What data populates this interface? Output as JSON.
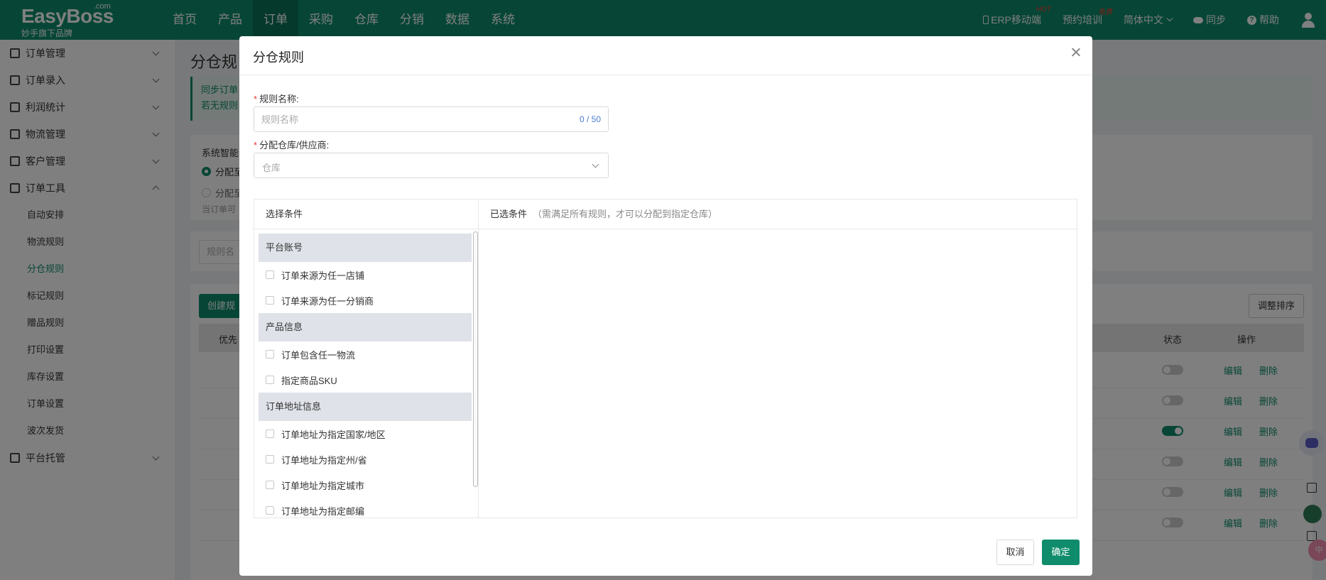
{
  "header": {
    "brand": "EasyBoss",
    "brand_suffix": ".com",
    "slogan": "妙手旗下品牌",
    "nav": [
      "首页",
      "产品",
      "订单",
      "采购",
      "仓库",
      "分销",
      "数据",
      "系统"
    ],
    "active_nav": "订单",
    "erp_mobile": "ERP移动端",
    "erp_badge": "HOT",
    "training": "预约培训",
    "training_badge": "免费",
    "language": "简体中文",
    "sync": "同步",
    "help": "帮助"
  },
  "sidebar": {
    "groups": [
      {
        "label": "订单管理",
        "expanded": false
      },
      {
        "label": "订单录入",
        "expanded": false
      },
      {
        "label": "利润统计",
        "expanded": false
      },
      {
        "label": "物流管理",
        "expanded": false
      },
      {
        "label": "客户管理",
        "expanded": false
      },
      {
        "label": "订单工具",
        "expanded": true
      }
    ],
    "sub_items": [
      "自动安排",
      "物流规则",
      "分仓规则",
      "标记规则",
      "赠品规则",
      "打印设置",
      "库存设置",
      "订单设置",
      "波次发货"
    ],
    "active_sub": "分仓规则",
    "last_group": {
      "label": "平台托管",
      "expanded": false
    }
  },
  "background": {
    "page_title": "分仓规",
    "notice_line1": "同步订单",
    "notice_line2": "若无规则",
    "smart_label": "系统智能",
    "radio1": "分配至",
    "radio2": "分配至",
    "hint": "当订单可",
    "search_placeholder": "规则名",
    "create_button": "创建规",
    "sort_button": "调整排序",
    "col_priority": "优先",
    "col_status": "状态",
    "col_action": "操作",
    "rows": [
      {
        "on": false,
        "edit": "编辑",
        "delete": "删除"
      },
      {
        "on": false,
        "edit": "编辑",
        "delete": "删除"
      },
      {
        "on": true,
        "edit": "编辑",
        "delete": "删除"
      },
      {
        "on": false,
        "edit": "编辑",
        "delete": "删除"
      },
      {
        "on": false,
        "edit": "编辑",
        "delete": "删除"
      },
      {
        "on": false,
        "edit": "编辑",
        "delete": "删除"
      }
    ],
    "float_badge": "中"
  },
  "modal": {
    "title": "分仓规则",
    "rule_name_label": "规则名称:",
    "rule_name_placeholder": "规则名称",
    "rule_name_value": "",
    "rule_name_counter": "0 / 50",
    "warehouse_label": "分配仓库/供应商:",
    "warehouse_placeholder": "仓库",
    "select_conditions_title": "选择条件",
    "selected_conditions_title": "已选条件",
    "selected_conditions_hint": "（需满足所有规则，才可以分配到指定仓库）",
    "condition_groups": [
      {
        "title": "平台账号",
        "items": [
          "订单来源为任一店铺",
          "订单来源为任一分销商"
        ]
      },
      {
        "title": "产品信息",
        "items": [
          "订单包含任一物流",
          "指定商品SKU"
        ]
      },
      {
        "title": "订单地址信息",
        "items": [
          "订单地址为指定国家/地区",
          "订单地址为指定州/省",
          "订单地址为指定城市",
          "订单地址为指定邮编"
        ]
      }
    ],
    "cancel": "取消",
    "confirm": "确定"
  }
}
